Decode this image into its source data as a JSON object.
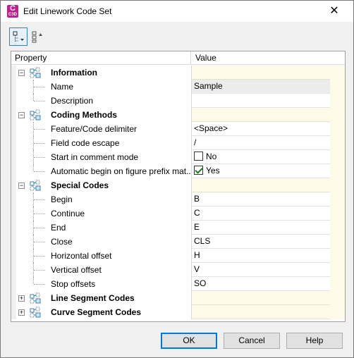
{
  "window": {
    "title": "Edit Linework Code Set",
    "app_icon_letter": "C",
    "app_icon_version": "C3D",
    "close_glyph": "✕"
  },
  "toolbar": {
    "buttons": [
      {
        "icon": "categorized-view-icon",
        "active": true
      },
      {
        "icon": "alphabetical-view-icon",
        "active": false
      }
    ]
  },
  "grid": {
    "columns": {
      "property": "Property",
      "value": "Value"
    },
    "rows": [
      {
        "type": "category",
        "label": "Information",
        "expanded": true,
        "value": ""
      },
      {
        "type": "property",
        "label": "Name",
        "value": "Sample",
        "readonly": true
      },
      {
        "type": "property",
        "label": "Description",
        "value": ""
      },
      {
        "type": "category",
        "label": "Coding Methods",
        "expanded": true,
        "value": ""
      },
      {
        "type": "property",
        "label": "Feature/Code delimiter",
        "value": "<Space>"
      },
      {
        "type": "property",
        "label": "Field code escape",
        "value": "/"
      },
      {
        "type": "property",
        "label": "Start in comment mode",
        "value": "No",
        "checkbox": true,
        "checked": false
      },
      {
        "type": "property",
        "label": "Automatic begin on figure prefix mat...",
        "value": "Yes",
        "checkbox": true,
        "checked": true
      },
      {
        "type": "category",
        "label": "Special Codes",
        "expanded": true,
        "value": ""
      },
      {
        "type": "property",
        "label": "Begin",
        "value": "B"
      },
      {
        "type": "property",
        "label": "Continue",
        "value": "C"
      },
      {
        "type": "property",
        "label": "End",
        "value": "E"
      },
      {
        "type": "property",
        "label": "Close",
        "value": "CLS"
      },
      {
        "type": "property",
        "label": "Horizontal offset",
        "value": "H"
      },
      {
        "type": "property",
        "label": "Vertical offset",
        "value": "V"
      },
      {
        "type": "property",
        "label": "Stop offsets",
        "value": "SO"
      },
      {
        "type": "category",
        "label": "Line Segment Codes",
        "expanded": false,
        "value": ""
      },
      {
        "type": "category",
        "label": "Curve Segment Codes",
        "expanded": false,
        "value": ""
      }
    ]
  },
  "buttons": {
    "ok": "OK",
    "cancel": "Cancel",
    "help": "Help"
  },
  "colors": {
    "accent": "#0078d7",
    "category_value_bg": "#fdfbe8",
    "app_icon": "#c0208a"
  }
}
